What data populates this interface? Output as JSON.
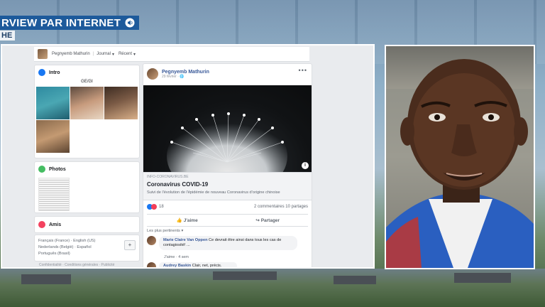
{
  "banner": {
    "title": "RVIEW PAR INTERNET",
    "subtitle": "HE"
  },
  "colors": {
    "banner_blue": "#1d5a9b",
    "fb_link_blue": "#385898",
    "like_blue": "#1877f2",
    "love_red": "#f33e58"
  },
  "facebook": {
    "topbar": {
      "profile_name": "Pegnyemb Mathurin",
      "journal": "Journal",
      "recent": "Récent"
    },
    "intro": {
      "title": "Intro",
      "tagline": "GE/GI"
    },
    "photos": {
      "title": "Photos"
    },
    "friends": {
      "title": "Amis"
    },
    "languages": {
      "line1": "Français (France) · English (US)",
      "line2": "Nederlands (België) · Español",
      "line3": "Português (Brasil)",
      "add_button": "+"
    },
    "footer": "Confidentialité · Conditions générales · Publicité",
    "post": {
      "author": "Pegnyemb Mathurin",
      "date": "29 février ·",
      "more": "•••",
      "link": {
        "domain": "INFO-CORONAVIRUS.BE",
        "title": "Coronavirus COVID-19",
        "description": "Suivi de l'évolution de l'épidémie de nouveau Coronavirus d'origine chinoise"
      },
      "reactions": {
        "count": "18",
        "summary": "2 commentaires 10 partages"
      },
      "actions": {
        "like": "J'aime",
        "share": "Partager"
      },
      "sort_label": "Les plus pertinents ▾",
      "comments": [
        {
          "author": "Marie Claire Van Oppen",
          "text": "Ce devrait être ainsi dans tous les cas de contagiosité! ...",
          "meta": "J'aime · 4 sem"
        },
        {
          "author": "Audrey Baskin",
          "text": "Clair, net, précis."
        }
      ]
    }
  }
}
